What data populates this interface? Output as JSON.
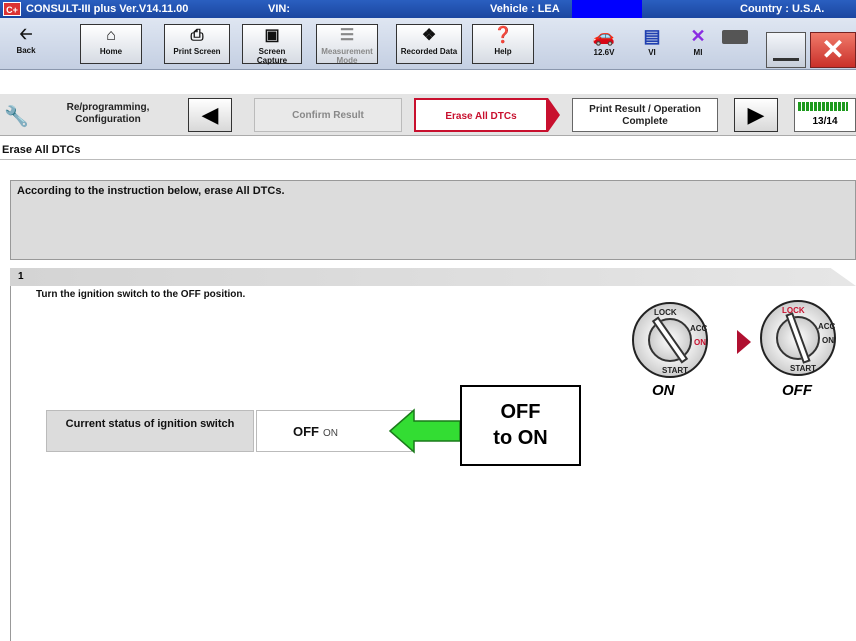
{
  "titlebar": {
    "logo": "C+",
    "app": "CONSULT-III plus  Ver.V14.11.00",
    "vin": "VIN:",
    "vehicle": "Vehicle : LEA",
    "country": "Country : U.S.A."
  },
  "toolbar": {
    "back": "Back",
    "home": "Home",
    "print_screen": "Print Screen",
    "screen_capture": "Screen Capture",
    "measurement_mode": "Measurement Mode",
    "recorded_data": "Recorded Data",
    "help": "Help",
    "voltage": "12.6V",
    "vi": "VI",
    "mi": "MI",
    "icons": {
      "back": "back-arrow-icon",
      "home": "home-icon",
      "print_screen": "printer-icon",
      "screen_capture": "camera-icon",
      "measurement_mode": "measurement-icon",
      "recorded_data": "recorded-data-icon",
      "help": "help-icon",
      "battery": "car-battery-icon",
      "vi": "vi-device-icon",
      "mi": "mi-disconnected-icon"
    }
  },
  "nav": {
    "main_label": "Re/programming, Configuration",
    "steps": [
      {
        "label": "Confirm Result",
        "state": "inactive"
      },
      {
        "label": "Erase All DTCs",
        "state": "active"
      },
      {
        "label": "Print Result / Operation Complete",
        "state": "next"
      }
    ],
    "progress_text": "13/14",
    "progress_fraction": 0.93
  },
  "page": {
    "title": "Erase All DTCs",
    "instruction": "According to the instruction below, erase All DTCs.",
    "step_number": "1",
    "step_text": "Turn the ignition switch to the OFF position."
  },
  "ignition": {
    "lock": "LOCK",
    "acc": "ACC",
    "on": "ON",
    "start": "START",
    "label_on": "ON",
    "label_off": "OFF"
  },
  "status": {
    "label": "Current status of ignition switch",
    "value": "OFF",
    "value_overlay": "ON"
  },
  "callout": {
    "line1": "OFF",
    "line2": "to ON"
  },
  "colors": {
    "titlebar": "#1b46a0",
    "active_step": "#c8102e",
    "callout_arrow": "#33dd33",
    "progress": "#1e9a1e"
  }
}
